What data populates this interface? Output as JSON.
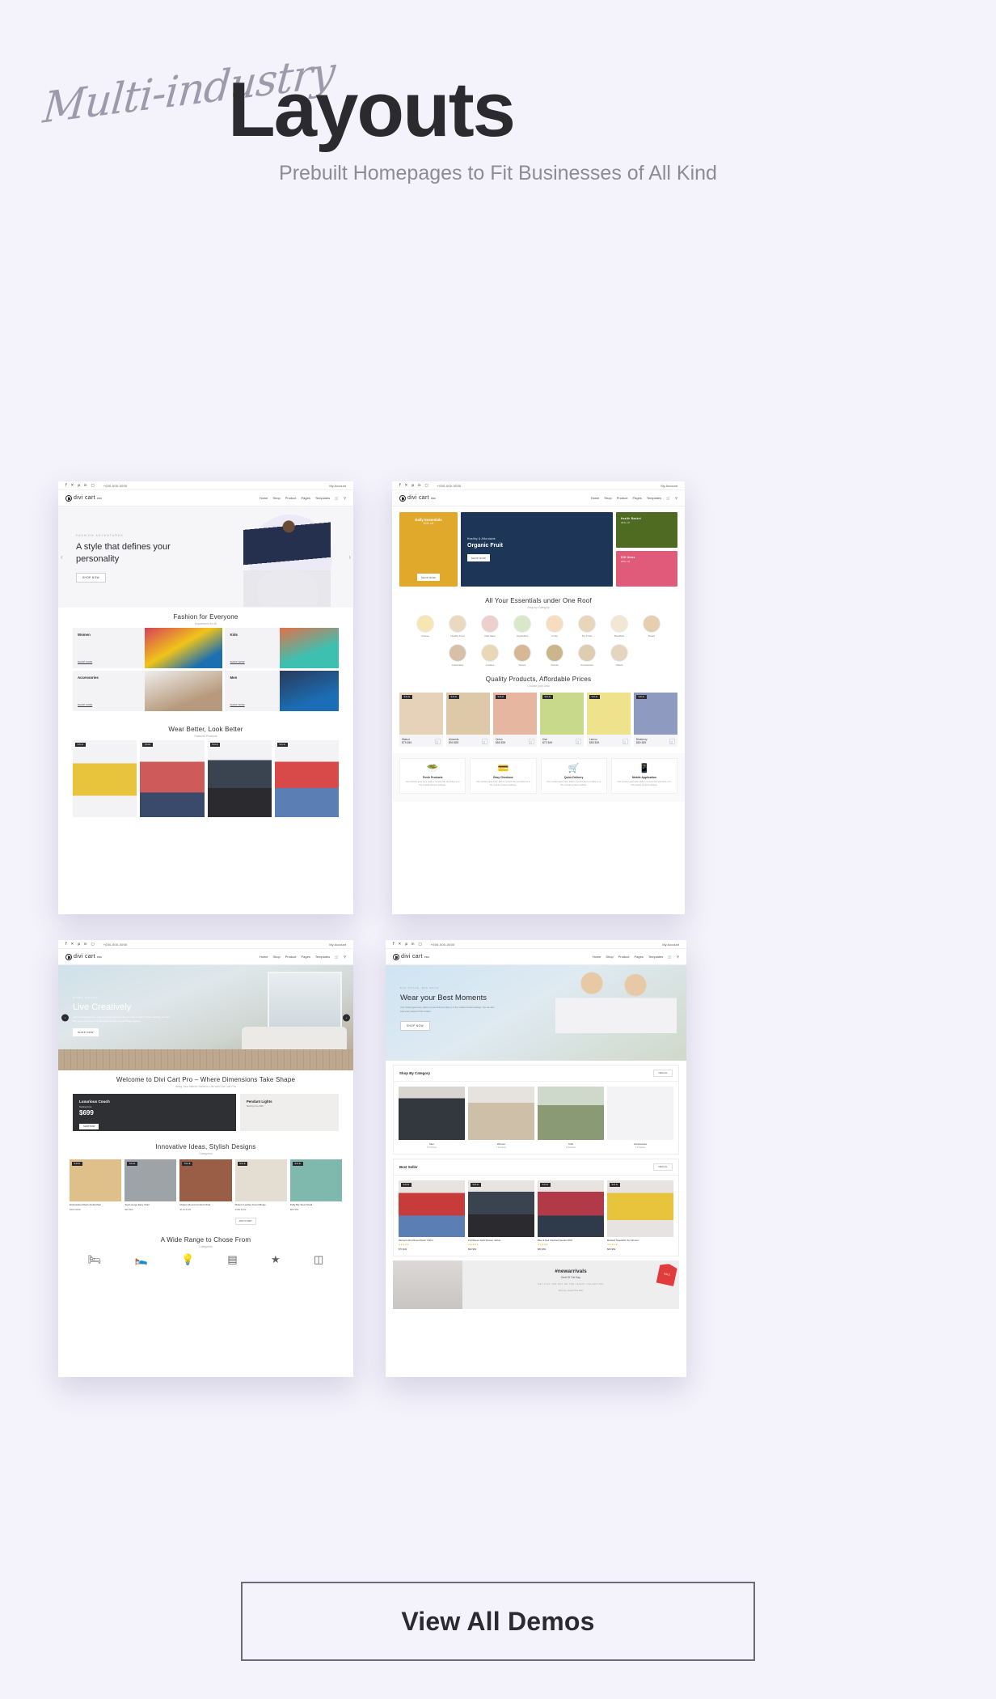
{
  "header": {
    "script_word": "Multi-industry",
    "title": "Layouts",
    "subtitle": "Prebuilt Homepages to Fit Businesses of All Kind"
  },
  "cta": {
    "label": "View All Demos"
  },
  "brand": {
    "logo_text": "divi cart",
    "logo_sup": "PRO",
    "phone": "+000-000-0000",
    "account": "My Account",
    "social": [
      "f",
      "t",
      "p",
      "in",
      "ig"
    ]
  },
  "nav": {
    "items": [
      "Home",
      "Shop",
      "Product",
      "Pages",
      "Templates"
    ],
    "icons": [
      "cart-icon",
      "search-icon"
    ]
  },
  "mockups": [
    {
      "name": "fashion",
      "hero": {
        "eyebrow": "FASHION ADVENTURES",
        "heading": "A style that defines your personality",
        "button": "SHOP NOW"
      },
      "section1": {
        "title": "Fashion for Everyone",
        "subtitle": "Department for All"
      },
      "categories": [
        {
          "label": "Women",
          "link": "SHOP NOW"
        },
        {
          "label": "Kids",
          "link": "SHOP NOW"
        },
        {
          "label": "Accessories",
          "link": "SHOP NOW"
        },
        {
          "label": "Men",
          "link": "SHOP NOW"
        }
      ],
      "section2": {
        "title": "Wear Better, Look Better",
        "subtitle": "Featured Products"
      },
      "products": [
        {
          "badge": "SALE"
        },
        {
          "badge": "SALE"
        },
        {
          "badge": "SALE"
        },
        {
          "badge": "SALE"
        }
      ]
    },
    {
      "name": "grocery",
      "banners": [
        {
          "small": "Daily Essentials",
          "large": "30% off",
          "button": "SHOP NOW",
          "color": "#e0a92b"
        },
        {
          "small": "Healthy & Affordable",
          "large": "Organic Fruit",
          "button": "SHOP NOW",
          "color": "#1d3557"
        },
        {
          "small": "Health Basket",
          "large": "30% off",
          "color": "#4f6b22"
        },
        {
          "small": "Gift Items",
          "large": "30% off",
          "color": "#e05a7a"
        }
      ],
      "section1": {
        "title": "All Your Essentials under One Roof",
        "subtitle": "Shop by Category"
      },
      "circle_categories": [
        "Cheese",
        "Healthy Food",
        "Raw Meat",
        "Vegetables",
        "Fruits",
        "Dry Fruits",
        "Breakfast",
        "Bread",
        "Chocolates",
        "Cookies",
        "Spices",
        "Sauces",
        "Accessories",
        "Others"
      ],
      "section2": {
        "title": "Quality Products, Affordable Prices",
        "subtitle": "Choose your Deal"
      },
      "products": [
        {
          "badge": "SALE",
          "name": "Walnut",
          "price": "$75 $49"
        },
        {
          "badge": "SALE",
          "name": "Almonds",
          "price": "$90 $59"
        },
        {
          "badge": "SALE",
          "name": "Onion",
          "price": "$55 $39"
        },
        {
          "badge": "SALE",
          "name": "Kiwi",
          "price": "$70 $49"
        },
        {
          "badge": "SALE",
          "name": "Lemon",
          "price": "$55 $39"
        },
        {
          "badge": "SALE",
          "name": "Blueberry",
          "price": "$80 $59"
        }
      ],
      "features": [
        {
          "icon": "fresh-products-icon",
          "title": "Fresh Products",
          "desc": "Your content goes here. Edit or remove this text inline or in the module Content settings."
        },
        {
          "icon": "easy-checkout-icon",
          "title": "Easy Checkout",
          "desc": "Your content goes here. Edit or remove this text inline or in the module Content settings."
        },
        {
          "icon": "quick-delivery-icon",
          "title": "Quick Delivery",
          "desc": "Your content goes here. Edit or remove this text inline or in the module Content settings."
        },
        {
          "icon": "mobile-application-icon",
          "title": "Mobile Application",
          "desc": "Your content goes here. Edit or remove this text inline or in the module Content settings."
        }
      ]
    },
    {
      "name": "furniture",
      "hero": {
        "eyebrow": "HOME DECOR",
        "heading": "Live Creatively",
        "paragraph": "Your content goes here. Edit or remove this text inline or in the module Content settings. You can also style every aspect of this content in the module Design settings.",
        "button": "SHOP NOW"
      },
      "section1": {
        "title": "Welcome to Divi Cart Pro – Where Dimensions Take Shape",
        "subtitle": "Bring Your Interior Vision to Life with Divi Cart Pro"
      },
      "promos": [
        {
          "label": "Luxurious Couch",
          "sub": "Starting From",
          "price": "$699",
          "button": "SHOP NOW"
        },
        {
          "label": "Pendant Lights",
          "sub": "Starting From $99"
        }
      ],
      "section2": {
        "title": "Innovative Ideas, Stylish Designs",
        "subtitle": "Categories"
      },
      "products": [
        {
          "badge": "SALE",
          "name": "Embroidered Retro Sofa Chair",
          "price": "$269 $199"
        },
        {
          "badge": "SALE",
          "name": "Teal Lounge Easy Chair",
          "price": "$99 $69"
        },
        {
          "badge": "SALE",
          "name": "Modern Round Comfort Chair",
          "price": "$149 $109"
        },
        {
          "badge": "SALE",
          "name": "Modern Leather Accent Beige",
          "price": "$189 $139",
          "button": "ADD TO CART"
        },
        {
          "badge": "SALE",
          "name": "Puffy Bar Stool Small",
          "price": "$89 $59"
        }
      ],
      "section3": {
        "title": "A Wide Range to Chose From",
        "subtitle": "Categories"
      },
      "icons": [
        "sofa-icon",
        "bed-icon",
        "lamp-icon",
        "table-icon",
        "chandelier-icon",
        "cabinet-icon"
      ]
    },
    {
      "name": "lifestyle",
      "hero": {
        "eyebrow": "BIG STYLE. BIG DAYS",
        "heading": "Wear your Best Moments",
        "paragraph": "Your content goes here. Edit or remove this text inline or in the module Content settings. You can also style every aspect of this content.",
        "button": "SHOP NOW"
      },
      "category_panel": {
        "title": "Shop By Category",
        "view_all": "VIEW ALL",
        "cards": [
          {
            "name": "Men",
            "count": "5 Products"
          },
          {
            "name": "Women",
            "count": "7 Products"
          },
          {
            "name": "Kids",
            "count": "4 Products"
          },
          {
            "name": "Accessories",
            "count": "6 Products"
          }
        ]
      },
      "bestseller_panel": {
        "title": "Best Seller",
        "view_all": "VIEW ALL",
        "cards": [
          {
            "badge": "SALE",
            "name": "Women's Red Round Neck T-Shirt",
            "stars": "★★★★★",
            "price": "$79 $49"
          },
          {
            "badge": "SALE",
            "name": "Full Sleeve Solid Women Jacket",
            "stars": "★★★★★",
            "price": "$99 $69"
          },
          {
            "badge": "SALE",
            "name": "Blue & Red Checked Hooded Shirt",
            "stars": "★★★★★",
            "price": "$89 $59"
          },
          {
            "badge": "SALE",
            "name": "Mustard Sweatshirt For Women",
            "stars": "★★★★★",
            "price": "$89 $59"
          }
        ]
      },
      "footer_promo": {
        "hashtag": "#newarrivals",
        "title": "Deal Of The Day",
        "caption": "GET FLAT 30% OFF ON THE LATEST COLLECTION",
        "sub": "Hurry Up, Limited Time Offer",
        "tag": "SALE"
      }
    }
  ]
}
